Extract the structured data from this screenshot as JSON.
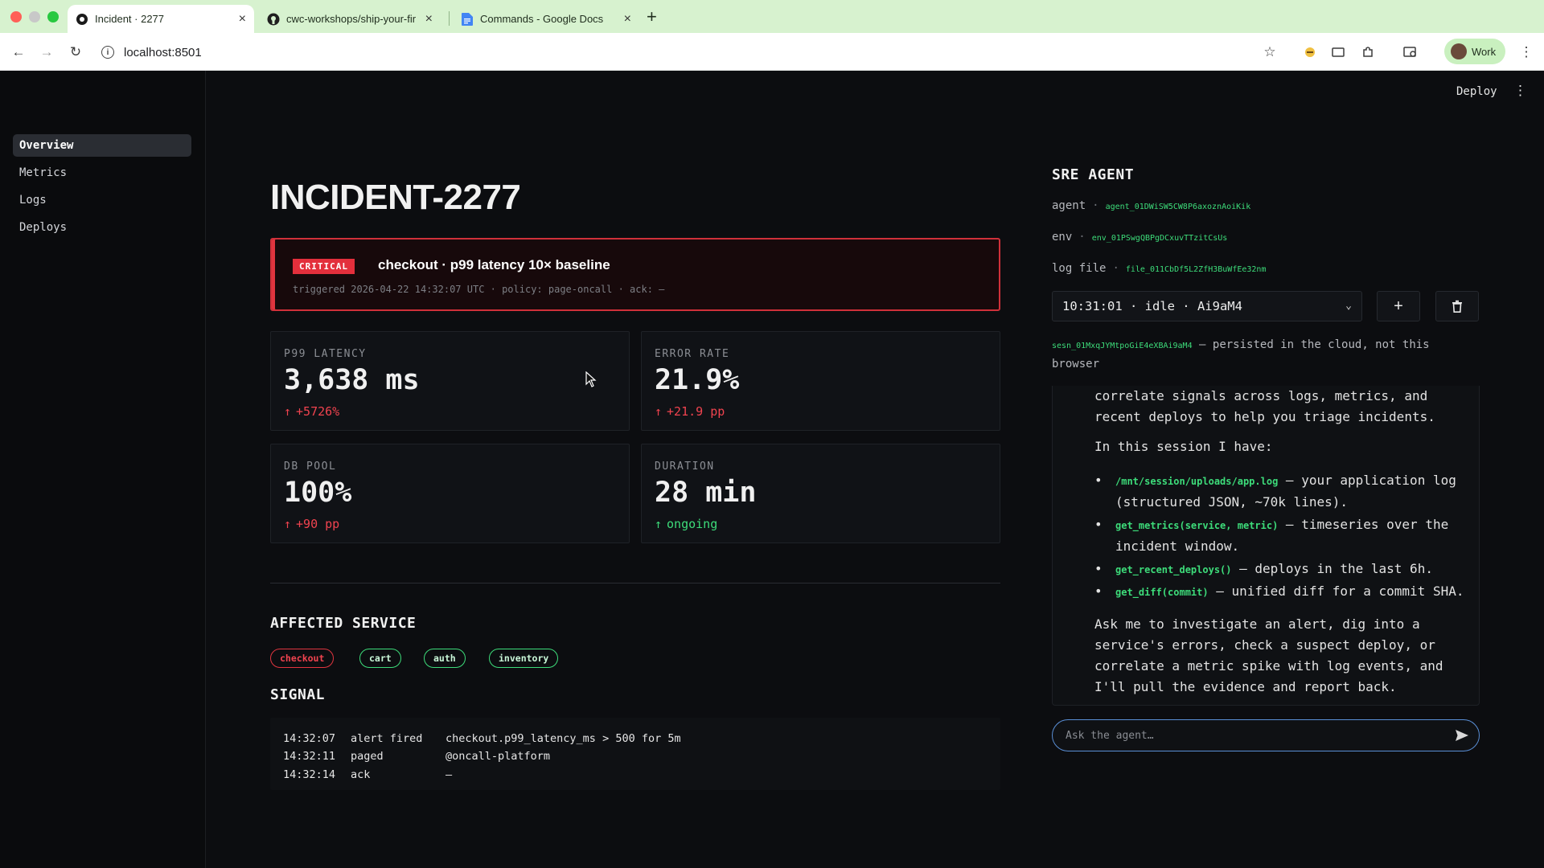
{
  "browser": {
    "tabs": [
      {
        "label": "Incident · 2277",
        "active": true
      },
      {
        "label": "cwc-workshops/ship-your-fir",
        "active": false
      },
      {
        "label": "Commands - Google Docs",
        "active": false
      }
    ],
    "url": "localhost:8501",
    "profile_label": "Work"
  },
  "sidebar": {
    "items": [
      {
        "label": "Overview",
        "active": true
      },
      {
        "label": "Metrics",
        "active": false
      },
      {
        "label": "Logs",
        "active": false
      },
      {
        "label": "Deploys",
        "active": false
      }
    ]
  },
  "header": {
    "deploy_label": "Deploy",
    "menu_icon": "kebab-menu-icon"
  },
  "incident": {
    "title": "INCIDENT-2277",
    "alert": {
      "severity": "CRITICAL",
      "title": "checkout · p99 latency 10× baseline",
      "meta": "triggered 2026-04-22 14:32:07 UTC · policy: page-oncall · ack: —"
    },
    "metrics": [
      {
        "label": "P99 LATENCY",
        "value": "3,638 ms",
        "delta": "+5726%",
        "status": "bad",
        "arrow": "↑"
      },
      {
        "label": "ERROR RATE",
        "value": "21.9%",
        "delta": "+21.9 pp",
        "status": "bad",
        "arrow": "↑"
      },
      {
        "label": "DB POOL",
        "value": "100%",
        "delta": "+90 pp",
        "status": "bad",
        "arrow": "↑"
      },
      {
        "label": "DURATION",
        "value": "28 min",
        "delta": "ongoing",
        "status": "ok",
        "arrow": "↑"
      }
    ],
    "affected_heading": "AFFECTED SERVICE",
    "services": [
      {
        "name": "checkout",
        "status": "bad"
      },
      {
        "name": "cart",
        "status": "ok"
      },
      {
        "name": "auth",
        "status": "ok"
      },
      {
        "name": "inventory",
        "status": "ok"
      }
    ],
    "signal_heading": "SIGNAL",
    "signals": [
      {
        "time": "14:32:07",
        "event": "alert fired",
        "detail": "checkout.p99_latency_ms > 500 for 5m"
      },
      {
        "time": "14:32:11",
        "event": "paged",
        "detail": "@oncall-platform"
      },
      {
        "time": "14:32:14",
        "event": "ack",
        "detail": "—"
      }
    ]
  },
  "agent": {
    "heading": "SRE AGENT",
    "agent_label": "agent",
    "agent_id": "agent_01DWiSW5CW8P6axoznAoiKik",
    "env_label": "env",
    "env_id": "env_01PSwgQBPgDCxuvTTzitCsUs",
    "log_label": "log file",
    "log_id": "file_011CbDf5L2ZfH3BuWfEe32nm",
    "session_value": "10:31:01 · idle · Ai9aM4",
    "session_id": "sesn_01MxqJYMtpoGiE4eXBAi9aM4",
    "session_note": " — persisted in the cloud, not this browser",
    "chat": {
      "intro": "correlate signals across logs, metrics, and recent deploys to help you triage incidents.",
      "have_label": "In this session I have:",
      "tools": [
        {
          "code": "/mnt/session/uploads/app.log",
          "desc": " — your application log (structured JSON, ~70k lines)."
        },
        {
          "code": "get_metrics(service, metric)",
          "desc": " — timeseries over the incident window."
        },
        {
          "code": "get_recent_deploys()",
          "desc": " — deploys in the last 6h."
        },
        {
          "code": "get_diff(commit)",
          "desc": " — unified diff for a commit SHA."
        }
      ],
      "outro": "Ask me to investigate an alert, dig into a service's errors, check a suspect deploy, or correlate a metric spike with log events, and I'll pull the evidence and report back."
    },
    "input_placeholder": "Ask the agent…"
  },
  "colors": {
    "critical": "#e32f3c",
    "ok_green": "#3ddc7a",
    "background": "#0c0d10",
    "browser_accent": "#d7f2cf"
  }
}
